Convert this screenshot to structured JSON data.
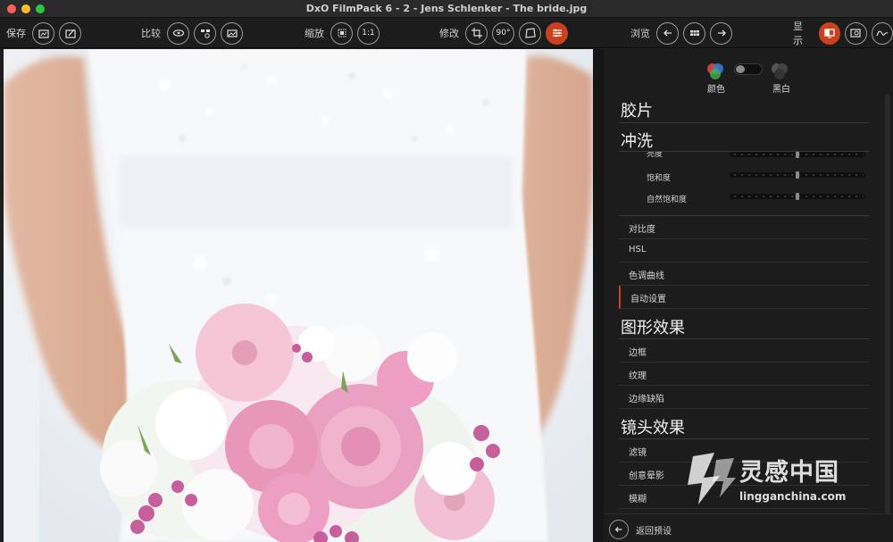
{
  "window": {
    "title": "DxO FilmPack 6 - 2 - Jens Schlenker - The bride.jpg",
    "traffic_colors": [
      "#fe5f57",
      "#febc2e",
      "#28c840"
    ]
  },
  "toolbar": {
    "save_label": "保存",
    "compare_label": "比较",
    "zoom_label": "缩放",
    "zoom_one_label": "1:1",
    "edit_label": "修改",
    "rotate_label": "90°",
    "browse_label": "浏览",
    "display_label": "显示",
    "accent": "#c9421f"
  },
  "panel": {
    "color_mode_label": "颜色",
    "bw_mode_label": "黑白",
    "sections": {
      "film": "胶片",
      "develop": "冲洗",
      "graphic": "图形效果",
      "lens": "镜头效果"
    },
    "develop_sub": {
      "brightness": "亮度",
      "saturation": "饱和度",
      "vibrance": "自然饱和度"
    },
    "develop_items": [
      "对比度",
      "HSL",
      "色调曲线",
      "自动设置"
    ],
    "graphic_items": [
      "边框",
      "纹理",
      "边缘缺陷"
    ],
    "lens_items": [
      "滤镜",
      "创意晕影",
      "模糊"
    ],
    "back_label": "返回预设"
  },
  "watermark": {
    "main": "灵感中国",
    "sub": "lingganchina.com"
  }
}
